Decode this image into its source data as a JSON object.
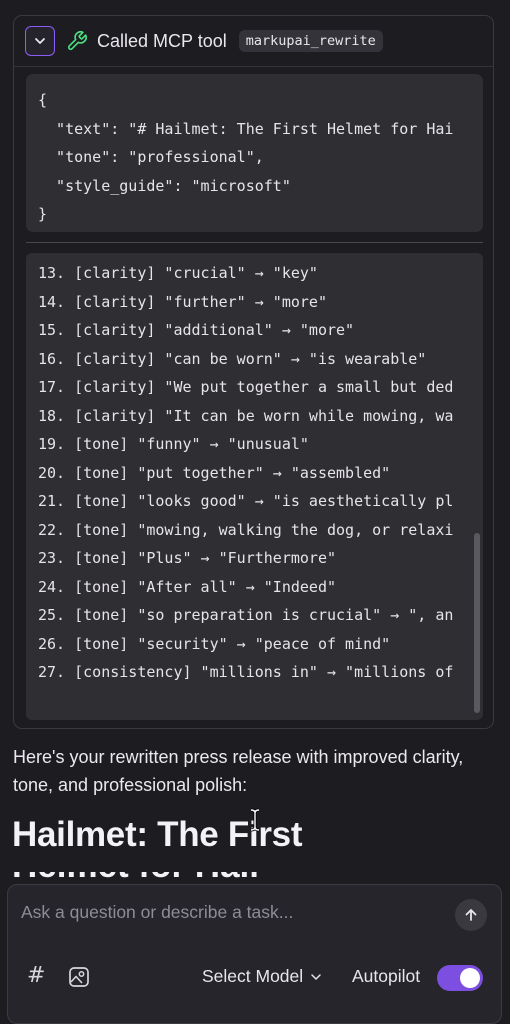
{
  "tool_call": {
    "title": "Called MCP tool",
    "tool_name": "markupai_rewrite",
    "input_code": "{\n  \"text\": \"# Hailmet: The First Helmet for Hai\n  \"tone\": \"professional\",\n  \"style_guide\": \"microsoft\"\n}",
    "output_lines": [
      "13. [clarity] \"crucial\" → \"key\"",
      "14. [clarity] \"further\" → \"more\"",
      "15. [clarity] \"additional\" → \"more\"",
      "16. [clarity] \"can be worn\" → \"is wearable\"",
      "17. [clarity] \"We put together a small but ded",
      "18. [clarity] \"It can be worn while mowing, wa",
      "19. [tone] \"funny\" → \"unusual\"",
      "20. [tone] \"put together\" → \"assembled\"",
      "21. [tone] \"looks good\" → \"is aesthetically pl",
      "22. [tone] \"mowing, walking the dog, or relaxi",
      "23. [tone] \"Plus\" → \"Furthermore\"",
      "24. [tone] \"After all\" → \"Indeed\"",
      "25. [tone] \"so preparation is crucial\" → \", an",
      "26. [tone] \"security\" → \"peace of mind\"",
      "27. [consistency] \"millions in\" → \"millions of"
    ]
  },
  "response": {
    "intro": "Here's your rewritten press release with improved clarity, tone, and professional polish:",
    "heading": "Hailmet: The First"
  },
  "composer": {
    "placeholder": "Ask a question or describe a task...",
    "hash_label": "#",
    "model_label": "Select Model",
    "autopilot_label": "Autopilot",
    "autopilot_on": true
  },
  "colors": {
    "accent": "#8b5cf6",
    "toggle": "#7c4fe0",
    "wrench": "#4ade80",
    "background": "#1d1c21"
  },
  "icons": [
    "chevron-down-icon",
    "wrench-icon",
    "arrow-up-icon",
    "image-icon",
    "text-cursor-icon"
  ]
}
